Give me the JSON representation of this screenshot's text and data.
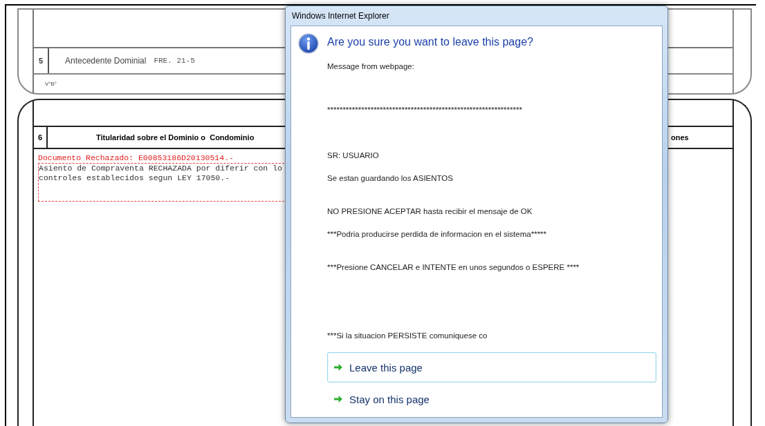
{
  "form": {
    "section_5": {
      "number": "5",
      "label": "Antecedente Dominial",
      "value": "FRE. 21-5",
      "approval": "V°B°"
    },
    "section_6": {
      "number": "6",
      "title": "Titularidad sobre el Dominio o  Condominio",
      "column_3": "ones",
      "rejection_notice": "Documento Rechazado: E00853186D20130514.-",
      "notes_lines": [
        "Asiento de Compraventa RECHAZADA por diferir con lo",
        "controles establecidos segun LEY 17050.-"
      ]
    }
  },
  "dialog": {
    "title": "Windows Internet Explorer",
    "heading": "Are you sure you want to leave this page?",
    "messages": [
      "Message from webpage:",
      "***************************************************************",
      "SR: USUARIO",
      "Se estan guardando los ASIENTOS",
      "NO PRESIONE ACEPTAR hasta recibir el mensaje de OK",
      "***Podria producirse perdida de informacion en el sistema*****",
      "***Presione CANCELAR e INTENTE en unos segundos o ESPERE ****",
      "***Si la situacion PERSISTE comuniquese co"
    ],
    "options": [
      {
        "label": "Leave this page",
        "selected": true
      },
      {
        "label": "Stay on this page",
        "selected": false
      }
    ]
  }
}
